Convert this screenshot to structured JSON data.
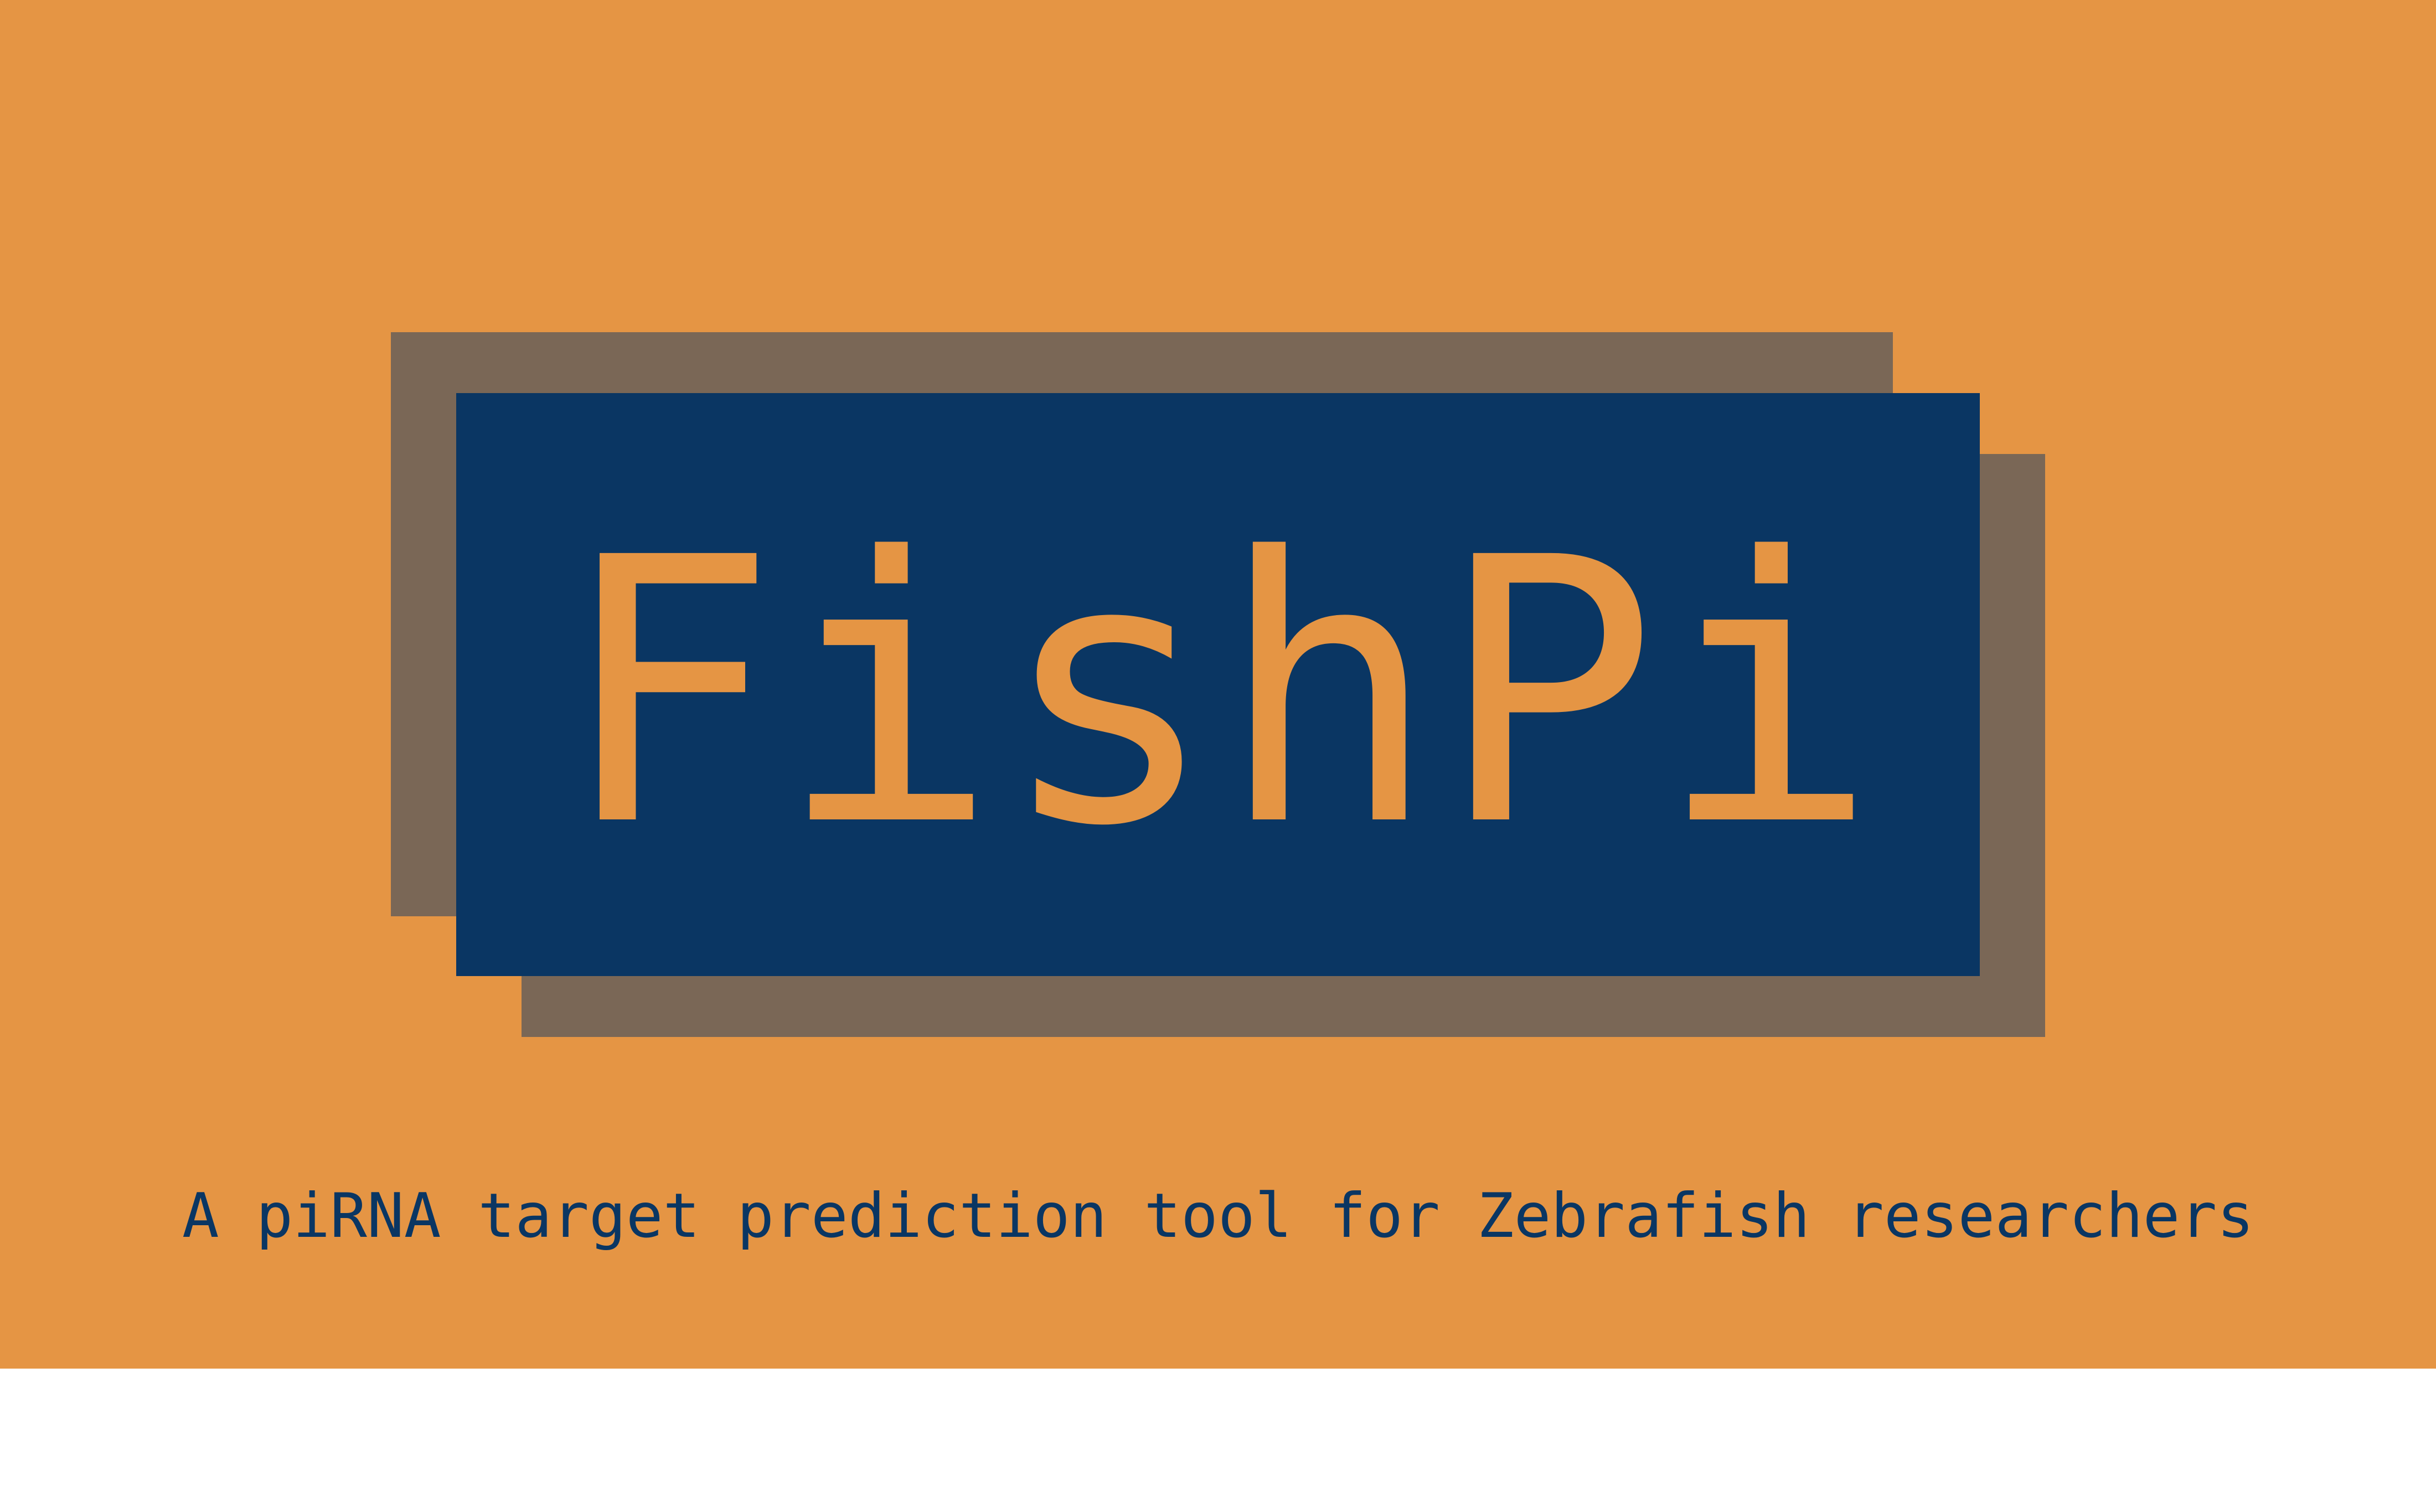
{
  "logo": {
    "title": "FishPi"
  },
  "tagline": "A piRNA target prediction tool for Zebrafish researchers",
  "colors": {
    "background": "#e59544",
    "logo_box": "#0a3663",
    "shadow": "#7a6756",
    "text_dark": "#0a3663",
    "text_light": "#e59544",
    "lower_area": "#ffffff"
  }
}
